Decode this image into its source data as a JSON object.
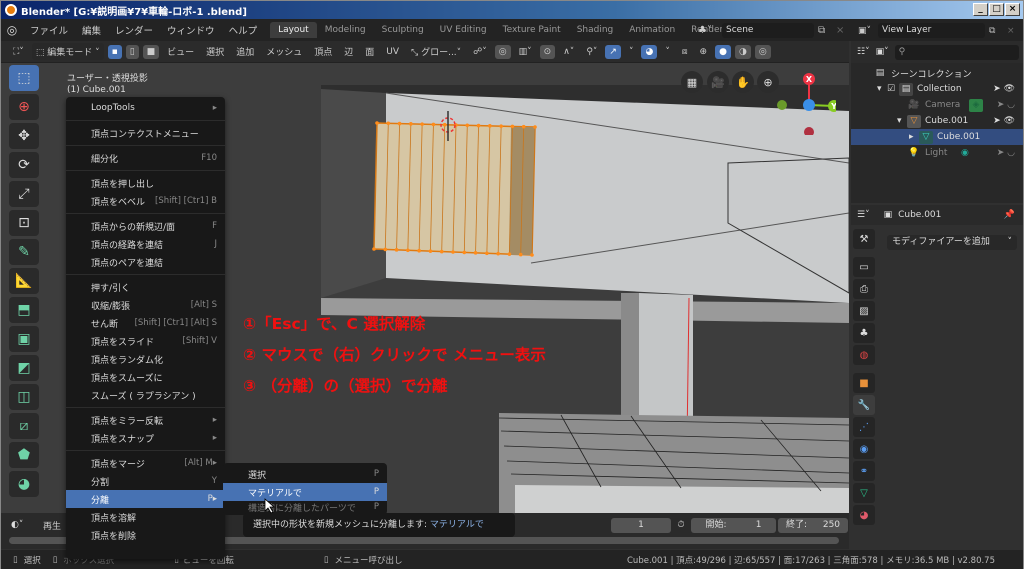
{
  "window": {
    "title": "Blender* [G:¥説明画¥7¥車輪-ロボ-1 .blend]",
    "controls": [
      "_",
      "□",
      "×"
    ]
  },
  "menubar": {
    "items": [
      "ファイル",
      "編集",
      "レンダー",
      "ウィンドウ",
      "ヘルプ"
    ]
  },
  "workspaces": {
    "tabs": [
      "Layout",
      "Modeling",
      "Sculpting",
      "UV Editing",
      "Texture Paint",
      "Shading",
      "Animation",
      "Renderir"
    ],
    "active": "Layout"
  },
  "scene": {
    "name": "Scene"
  },
  "view_layer": {
    "name": "View Layer"
  },
  "toolbar": {
    "mode": "編集モード",
    "menus": [
      "ビュー",
      "選択",
      "追加",
      "メッシュ",
      "頂点",
      "辺",
      "面",
      "UV"
    ],
    "transform_orientation": "グロー..."
  },
  "viewport": {
    "view_label": "ユーザー・透視投影",
    "object_label": "(1) Cube.001",
    "gizmo_x": "X",
    "gizmo_y": "Y"
  },
  "annotations": [
    "①「Esc」で、C 選択解除",
    "② マウスで（右）クリックで メニュー表示",
    "③ （分離）の（選択）で分離"
  ],
  "context_menu": {
    "groups": [
      [
        {
          "label": "LoopTools",
          "shortcut": "▸"
        }
      ],
      [
        {
          "label": "頂点コンテクストメニュー",
          "shortcut": ""
        }
      ],
      [
        {
          "label": "細分化",
          "shortcut": "F10"
        }
      ],
      [
        {
          "label": "頂点を押し出し",
          "shortcut": ""
        },
        {
          "label": "頂点をベベル",
          "shortcut": "[Shift] [Ctr1] B"
        }
      ],
      [
        {
          "label": "頂点からの新規辺/面",
          "shortcut": "F"
        },
        {
          "label": "頂点の経路を連結",
          "shortcut": "J"
        },
        {
          "label": "頂点のペアを連結",
          "shortcut": ""
        }
      ],
      [
        {
          "label": "押す/引く",
          "shortcut": ""
        },
        {
          "label": "収縮/膨張",
          "shortcut": "[Alt] S"
        },
        {
          "label": "せん断",
          "shortcut": "[Shift] [Ctr1] [Alt] S"
        },
        {
          "label": "頂点をスライド",
          "shortcut": "[Shift] V"
        },
        {
          "label": "頂点をランダム化",
          "shortcut": ""
        },
        {
          "label": "頂点をスムーズに",
          "shortcut": ""
        },
        {
          "label": "スムーズ ( ラプラシアン )",
          "shortcut": ""
        }
      ],
      [
        {
          "label": "頂点をミラー反転",
          "shortcut": "▸"
        },
        {
          "label": "頂点をスナップ",
          "shortcut": "▸"
        }
      ],
      [
        {
          "label": "頂点をマージ",
          "shortcut": "[Alt] M▸"
        },
        {
          "label": "分割",
          "shortcut": "Y"
        },
        {
          "label": "分離",
          "shortcut": "P▸",
          "highlighted": true
        },
        {
          "label": "頂点を溶解",
          "shortcut": ""
        },
        {
          "label": "頂点を削除",
          "shortcut": ""
        }
      ]
    ]
  },
  "submenu": {
    "items": [
      {
        "label": "選択",
        "shortcut": "P"
      },
      {
        "label": "マテリアルで",
        "shortcut": "P",
        "highlighted": true
      },
      {
        "label": "構造的に分離したパーツで",
        "shortcut": "P"
      }
    ]
  },
  "tooltip": {
    "text": "選択中の形状を新規メッシュに分離します: ",
    "highlight": "マテリアルで"
  },
  "timeline": {
    "playback": "再生",
    "current_frame": "1",
    "start_label": "開始:",
    "start": "1",
    "end_label": "終了:",
    "end": "250"
  },
  "statusbar": {
    "select": "選択",
    "box_select": "ボックス選択",
    "rotate": "ビューを回転",
    "call_menu": "メニュー呼び出し",
    "stats": "Cube.001 | 頂点:49/296 | 辺:65/557 | 面:17/263 | 三角面:578 | メモリ:36.5 MB | v2.80.75"
  },
  "outliner": {
    "root": "シーンコレクション",
    "items": [
      {
        "name": "Collection",
        "type": "collection"
      },
      {
        "name": "Camera",
        "type": "camera",
        "dim": true
      },
      {
        "name": "Cube.001",
        "type": "mesh-object"
      },
      {
        "name": "Cube.001",
        "type": "mesh-data",
        "selected": true
      },
      {
        "name": "Light",
        "type": "light",
        "dim": true
      }
    ]
  },
  "properties": {
    "object": "Cube.001",
    "add_modifier": "モディファイアーを追加"
  },
  "colors": {
    "accent": "#4772b3",
    "annotation": "#f01010",
    "selection": "#ff8c1a"
  }
}
